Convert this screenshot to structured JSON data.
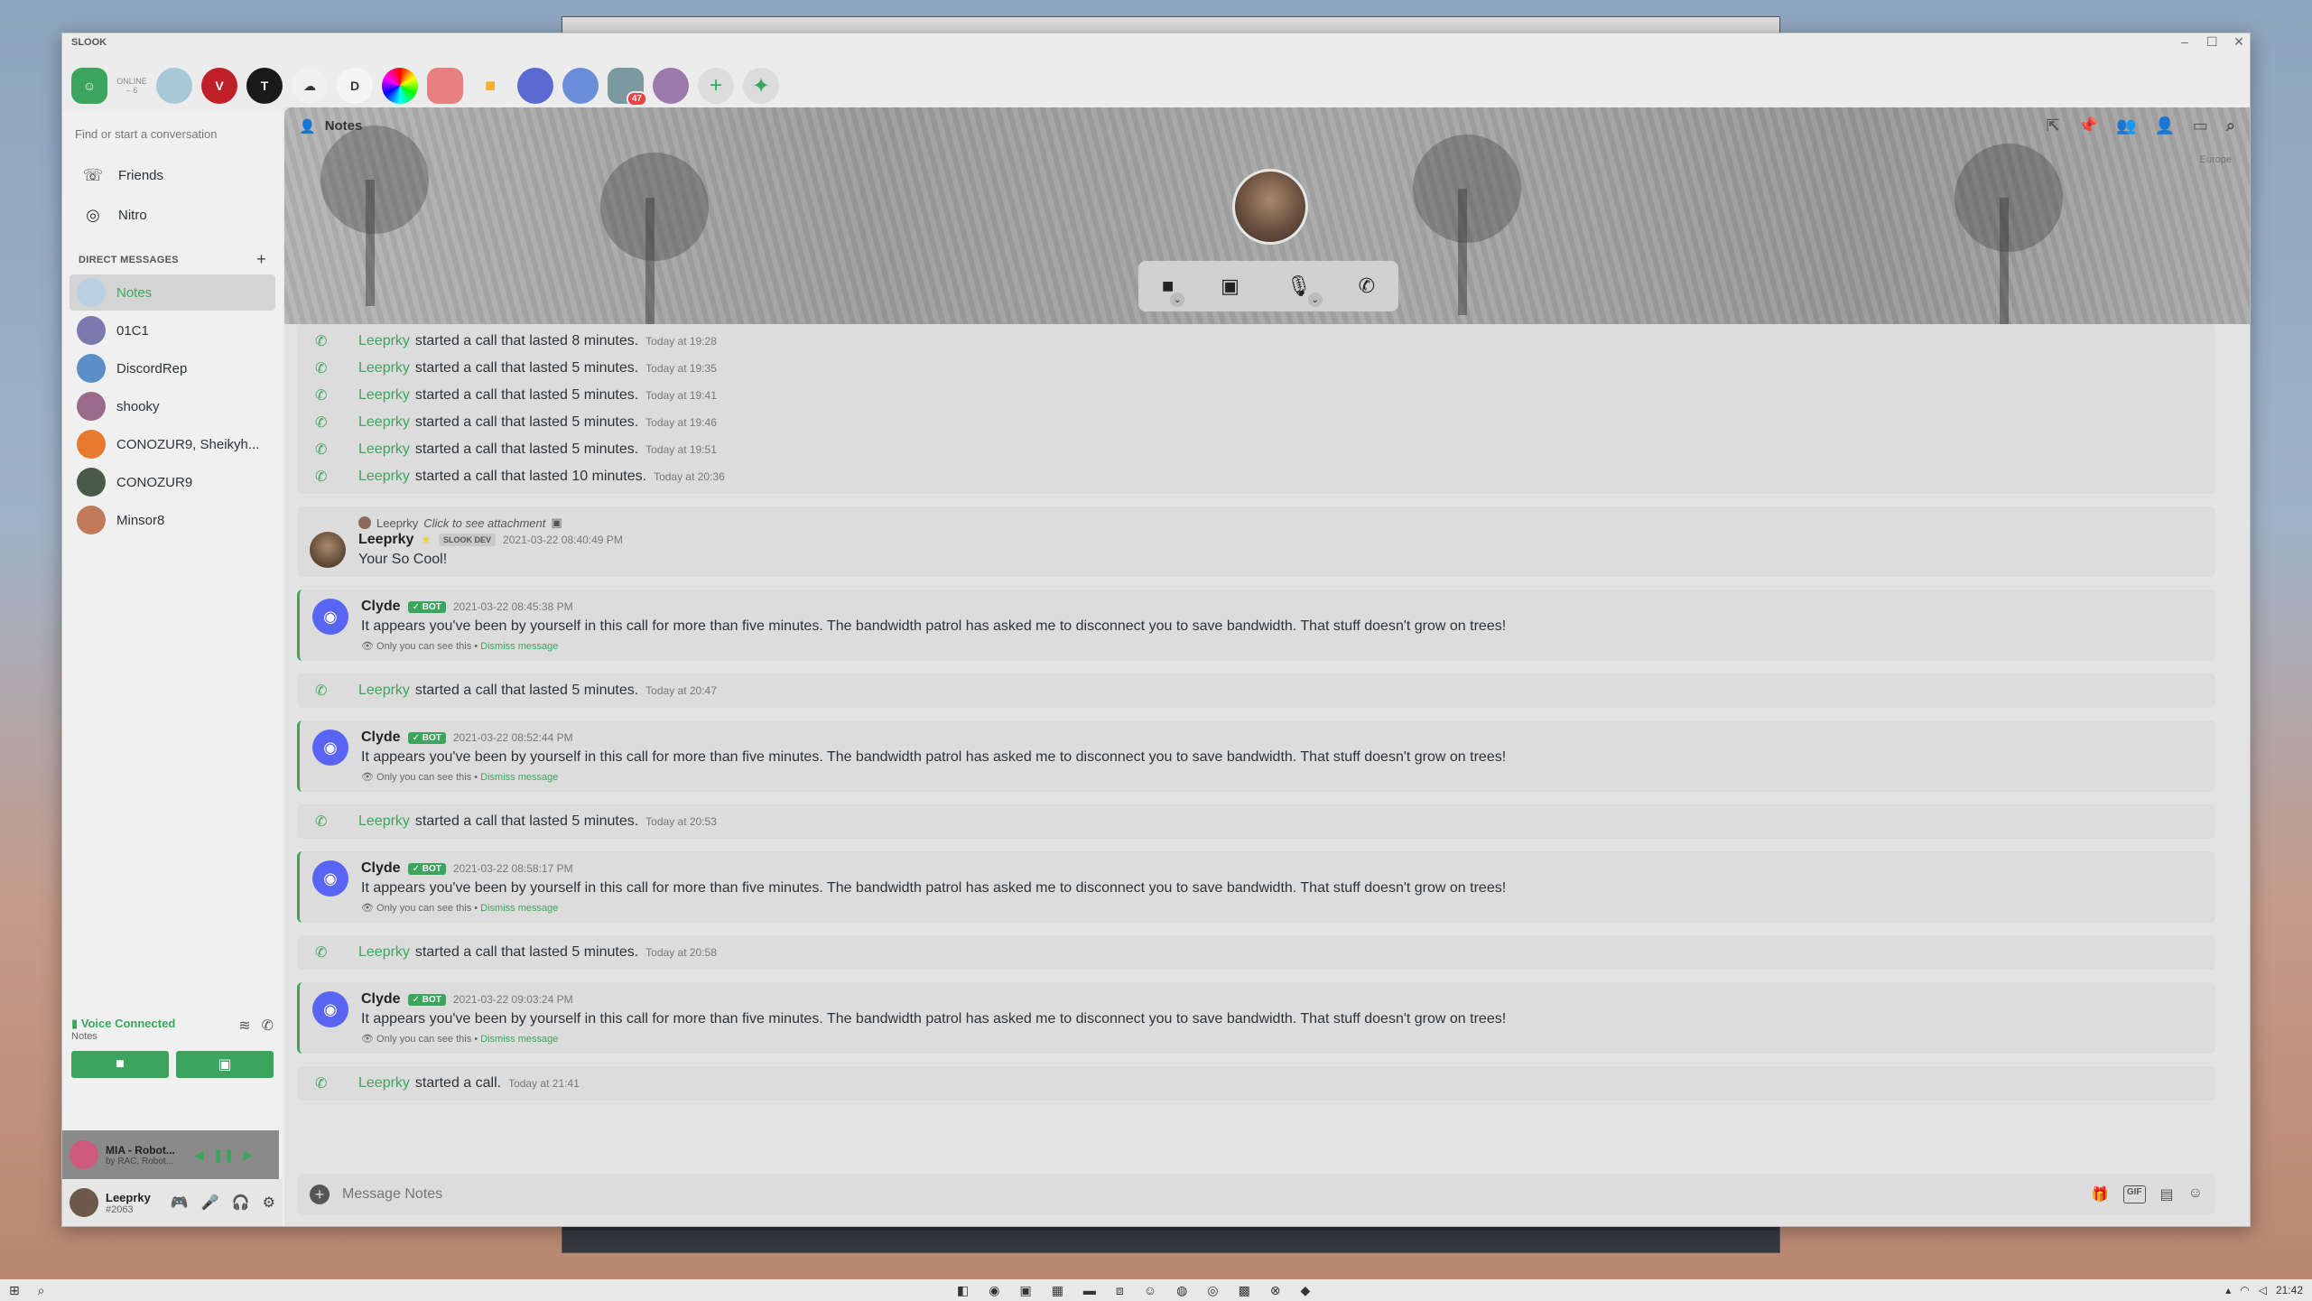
{
  "app": {
    "title": "SLOOK",
    "controls": [
      "–",
      "☐",
      "✕"
    ]
  },
  "guilds": {
    "online_label": "ONLINE",
    "online_count": "– 6",
    "letter_server": "D",
    "badge_count": "47"
  },
  "sidebar": {
    "search_placeholder": "Find or start a conversation",
    "nav": [
      {
        "label": "Friends",
        "icon": "friends-icon"
      },
      {
        "label": "Nitro",
        "icon": "nitro-icon"
      }
    ],
    "dm_header": "DIRECT MESSAGES",
    "dms": [
      {
        "name": "Notes",
        "color": "#b8d0e0",
        "active": true
      },
      {
        "name": "01C1",
        "color": "#7a7ab0"
      },
      {
        "name": "DiscordRep",
        "color": "#5b8ec7"
      },
      {
        "name": "shooky",
        "color": "#9a6a8a"
      },
      {
        "name": "CONOZUR9, Sheikyh...",
        "color": "#e87a30"
      },
      {
        "name": "CONOZUR9",
        "color": "#4a5a4a"
      },
      {
        "name": "Minsor8",
        "color": "#c07a5a"
      }
    ]
  },
  "voice": {
    "status": "Voice Connected",
    "channel": "Notes"
  },
  "spotify": {
    "song": "MIA - Robot...",
    "artist": "by RAC, Robot..."
  },
  "user": {
    "name": "Leeprky",
    "tag": "#2063"
  },
  "chat": {
    "channel_name": "Notes",
    "region": "Europe",
    "composer_placeholder": "Message Notes",
    "gif_label": "GIF",
    "call_lines_top": [
      {
        "who": "Leeprky",
        "text": "started a call that lasted 8 minutes.",
        "ts": "Today at 19:28"
      },
      {
        "who": "Leeprky",
        "text": "started a call that lasted 5 minutes.",
        "ts": "Today at 19:35"
      },
      {
        "who": "Leeprky",
        "text": "started a call that lasted 5 minutes.",
        "ts": "Today at 19:41"
      },
      {
        "who": "Leeprky",
        "text": "started a call that lasted 5 minutes.",
        "ts": "Today at 19:46"
      },
      {
        "who": "Leeprky",
        "text": "started a call that lasted 5 minutes.",
        "ts": "Today at 19:51"
      },
      {
        "who": "Leeprky",
        "text": "started a call that lasted 10 minutes.",
        "ts": "Today at 20:36"
      }
    ],
    "reply_msg": {
      "reply_author": "Leeprky",
      "reply_text": "Click to see attachment",
      "author": "Leeprky",
      "tag": "SLOOK DEV",
      "time": "2021-03-22 08:40:49 PM",
      "text": "Your So Cool!"
    },
    "clyde": {
      "author": "Clyde",
      "bot_tag": "✓ BOT",
      "text": "It appears you've been by yourself in this call for more than five minutes. The bandwidth patrol has asked me to disconnect you to save bandwidth. That stuff doesn't grow on trees!",
      "note": "Only you can see this •",
      "dismiss": "Dismiss message",
      "times": [
        "2021-03-22 08:45:38 PM",
        "2021-03-22 08:52:44 PM",
        "2021-03-22 08:58:17 PM",
        "2021-03-22 09:03:24 PM"
      ]
    },
    "mid_calls": [
      {
        "who": "Leeprky",
        "text": "started a call that lasted 5 minutes.",
        "ts": "Today at 20:47"
      },
      {
        "who": "Leeprky",
        "text": "started a call that lasted 5 minutes.",
        "ts": "Today at 20:53"
      },
      {
        "who": "Leeprky",
        "text": "started a call that lasted 5 minutes.",
        "ts": "Today at 20:58"
      }
    ],
    "last_call": {
      "who": "Leeprky",
      "text": "started a call.",
      "ts": "Today at 21:41"
    }
  },
  "taskbar": {
    "time": "21:42"
  }
}
